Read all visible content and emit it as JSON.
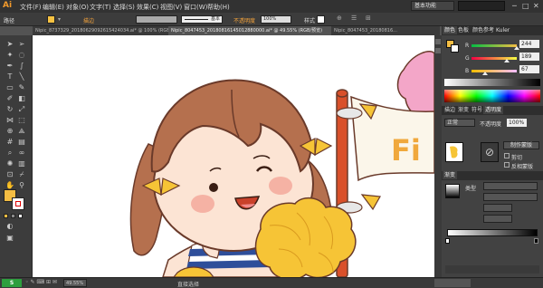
{
  "app": {
    "logo": "Ai"
  },
  "menu": {
    "items": [
      "文件(F)",
      "编辑(E)",
      "对象(O)",
      "文字(T)",
      "选择(S)",
      "效果(C)",
      "视图(V)",
      "窗口(W)",
      "帮助(H)"
    ],
    "workspace": "基本功能"
  },
  "control": {
    "label": "路径",
    "fill_color": "#f6c242",
    "stroke_label": "描边",
    "stroke_style": "基本",
    "opacity_label": "不透明度",
    "opacity_value": "100%",
    "style_label": "样式"
  },
  "tabs": [
    {
      "label": "Nipic_8737329_20180629092615424034.ai* @ 100% (RGB/...",
      "active": false
    },
    {
      "label": "Nipic_8047453_20180816145012880000.ai* @ 49.55% (RGB/预览)",
      "active": true
    },
    {
      "label": "Nipic_8047453_20180816...",
      "active": false
    }
  ],
  "color_panel": {
    "tabs": [
      "颜色",
      "色板",
      "颜色参考",
      "Kuler"
    ],
    "r_label": "R",
    "r_value": "244",
    "g_label": "G",
    "g_value": "189",
    "b_label": "B",
    "b_value": "67",
    "fill_color": "#f4bd43"
  },
  "transparency_panel": {
    "tabs": [
      "描边",
      "渐变",
      "符号",
      "透明度"
    ],
    "blend_mode": "正常",
    "opacity_label": "不透明度",
    "opacity_value": "100%",
    "make_mask_button": "制作蒙版",
    "clip_label": "剪切",
    "invert_label": "反相蒙版"
  },
  "gradient_panel": {
    "tabs": [
      "渐变"
    ],
    "type_label": "类型"
  },
  "status": {
    "zoom": "49.55%",
    "tool": "直接选择"
  },
  "artwork": {
    "flag_text": "Fi",
    "skin_color": "#fce4d4",
    "hair_color": "#b5704e",
    "pompom_color": "#f6c436",
    "pole_color": "#d9502a",
    "stripe_color": "#2e4e9a",
    "pink_color": "#f3a6c8",
    "cheek_color": "#f5b2a4"
  }
}
